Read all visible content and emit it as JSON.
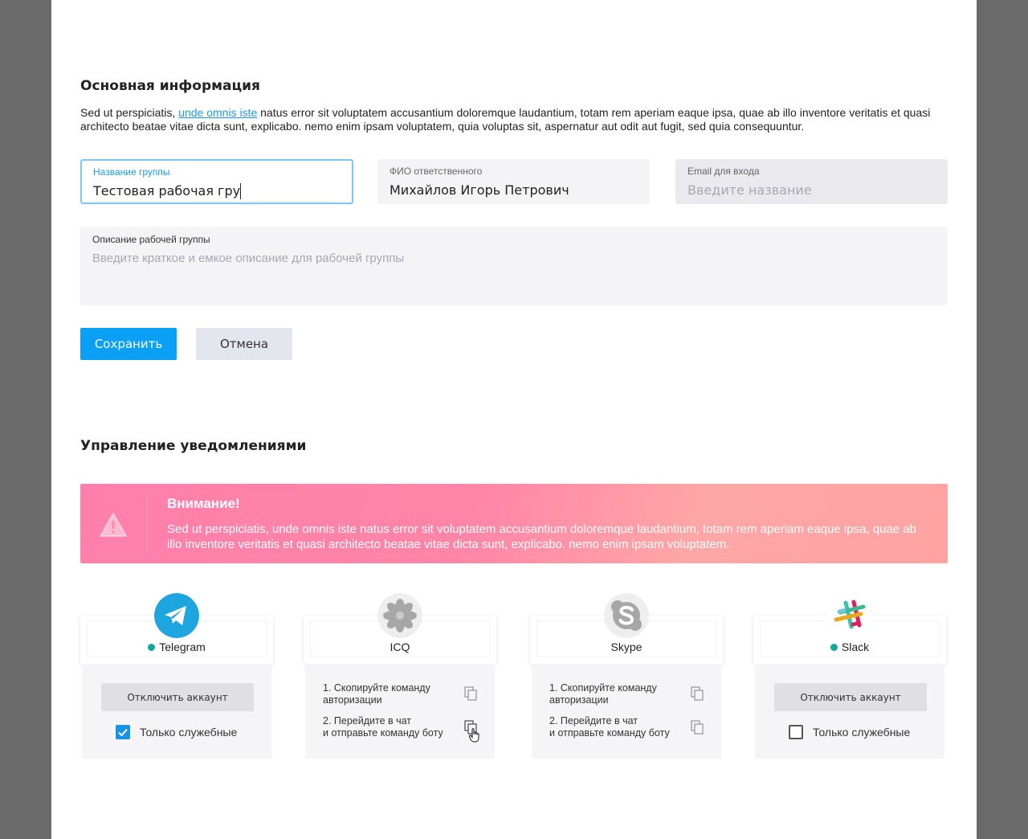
{
  "main_info": {
    "title": "Основная информация",
    "intro_before": "Sed ut perspiciatis, ",
    "intro_link": "unde omnis iste",
    "intro_after": " natus error sit voluptatem accusantium doloremque laudantium, totam rem aperiam eaque ipsa, quae ab illo inventore veritatis et quasi architecto beatae vitae dicta sunt, explicabo. nemo enim ipsam voluptatem, quia voluptas sit, aspernatur aut odit aut fugit, sed quia consequuntur."
  },
  "form": {
    "group_name": {
      "label": "Название группы",
      "value": "Тестовая рабочая гру"
    },
    "responsible": {
      "label": "ФИО ответственного",
      "value": "Михайлов Игорь Петрович"
    },
    "email": {
      "label": "Email для входа",
      "placeholder": "Введите название"
    },
    "description": {
      "label": "Описание рабочей группы",
      "placeholder": "Введите краткое и емкое описание для рабочей группы"
    }
  },
  "buttons": {
    "save": "Сохранить",
    "cancel": "Отмена"
  },
  "notifications": {
    "title": "Управление уведомлениями",
    "alert": {
      "title": "Внимание!",
      "text": "Sed ut perspiciatis, unde omnis iste natus error sit voluptatem accusantium doloremque laudantium, totam rem aperiam eaque ipsa, quae ab illo inventore veritatis et quasi architecto beatae vitae dicta sunt, explicabo. nemo enim ipsam voluptatem."
    },
    "services": [
      {
        "name": "Telegram",
        "connected": true,
        "disconnect_label": "Отключить аккаунт",
        "only_service_label": "Только служебные",
        "only_service_checked": true
      },
      {
        "name": "ICQ",
        "connected": false,
        "step1": "1. Скопируйте команду авторизации",
        "step2_line1": "2. Перейдите в чат",
        "step2_line2": "и отправьте команду боту"
      },
      {
        "name": "Skype",
        "connected": false,
        "step1": "1. Скопируйте команду авторизации",
        "step2_line1": "2. Перейдите в чат",
        "step2_line2": "и отправьте команду боту"
      },
      {
        "name": "Slack",
        "connected": true,
        "disconnect_label": "Отключить аккаунт",
        "only_service_label": "Только служебные",
        "only_service_checked": false
      }
    ]
  },
  "colors": {
    "primary": "#0aa0f5",
    "link": "#1a9be6",
    "connected_dot": "#13a89e",
    "alert_start": "#ff7fab",
    "alert_end": "#ffa3a3"
  },
  "icons": [
    "warning-icon",
    "telegram-icon",
    "icq-icon",
    "skype-icon",
    "slack-icon",
    "copy-icon",
    "hand-cursor-icon",
    "checkbox-checked-icon"
  ]
}
